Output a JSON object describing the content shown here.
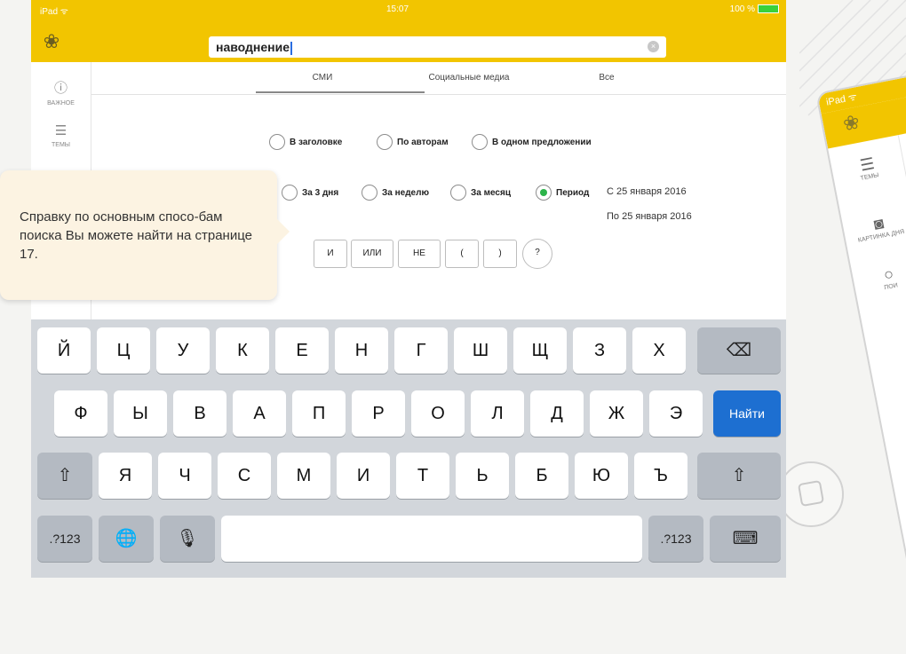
{
  "status": {
    "left": "iPad ᯤ",
    "time": "15:07",
    "battery": "100 %"
  },
  "search": {
    "query": "наводнение",
    "clear": "×"
  },
  "sidebar": {
    "items": [
      {
        "label": "ВАЖНОЕ"
      },
      {
        "label": "ТЕМЫ"
      }
    ]
  },
  "tabs": [
    {
      "label": "СМИ"
    },
    {
      "label": "Социальные медиа"
    },
    {
      "label": "Все"
    }
  ],
  "filters": {
    "scope": [
      "В заголовке",
      "По авторам",
      "В одном предложении"
    ],
    "period": [
      "За 3 дня",
      "За неделю",
      "За месяц",
      "Период"
    ],
    "selected_period": "Период",
    "date_from": "С 25 января 2016",
    "date_to": "По 25 января 2016"
  },
  "operators": [
    "И",
    "ИЛИ",
    "НЕ",
    "(",
    ")",
    "?"
  ],
  "tooltip": {
    "text": "Справку по основным спосо-бам поиска Вы можете найти на странице 17."
  },
  "keyboard": {
    "row1": [
      "Й",
      "Ц",
      "У",
      "К",
      "Е",
      "Н",
      "Г",
      "Ш",
      "Щ",
      "З",
      "Х"
    ],
    "row2": [
      "Ф",
      "Ы",
      "В",
      "А",
      "П",
      "Р",
      "О",
      "Л",
      "Д",
      "Ж",
      "Э"
    ],
    "row3": [
      "Я",
      "Ч",
      "С",
      "М",
      "И",
      "Т",
      "Ь",
      "Б",
      "Ю",
      "Ъ"
    ],
    "search_key": "Найти",
    "numbers_key": ".?123",
    "delete_icon": "⌫",
    "shift_icon": "⇧",
    "globe_icon": "🌐",
    "mic_icon": "🎙",
    "hide_keyboard_icon": "⌨"
  },
  "ipad2": {
    "status": "iPad ᯤ",
    "items": [
      {
        "label": "ТЕМЫ"
      },
      {
        "label": "КАРТИНКА ДНЯ"
      },
      {
        "label": "ПОИ"
      }
    ]
  },
  "colors": {
    "brand_yellow": "#f2c500",
    "accent_blue": "#1d6fd1",
    "radio_green": "#2cb34a",
    "tooltip_bg": "#fcf3e2"
  }
}
